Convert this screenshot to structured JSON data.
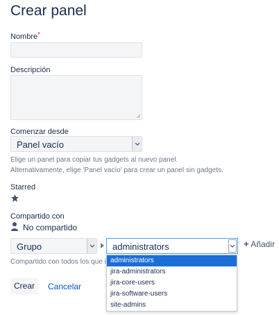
{
  "page": {
    "title": "Crear panel"
  },
  "form": {
    "name_label": "Nombre",
    "name_required": "*",
    "name_value": "",
    "description_label": "Descripción",
    "description_value": "",
    "start_label": "Comenzar desde",
    "start_value": "Panel vacío",
    "start_help_1": "Elige un panel para copiar tus gadgets al nuevo panel.",
    "start_help_2": "Alternativamente, elige 'Panel vacío' para crear un panel sin gadgets.",
    "starred_label": "Starred",
    "shared_label": "Compartido con",
    "shared_value": "No compartido",
    "share_type_value": "Grupo",
    "group_value": "administrators",
    "add_label": "Añadir",
    "share_help": "Compartido con todos los que inte",
    "group_options": [
      "administrators",
      "jira-administrators",
      "jira-core-users",
      "jira-software-users",
      "site-admins"
    ],
    "selected_option_index": 0
  },
  "actions": {
    "create_label": "Crear",
    "cancel_label": "Cancelar"
  },
  "colors": {
    "link": "#0052cc",
    "selected": "#1a6ed8",
    "required": "#de350b"
  }
}
